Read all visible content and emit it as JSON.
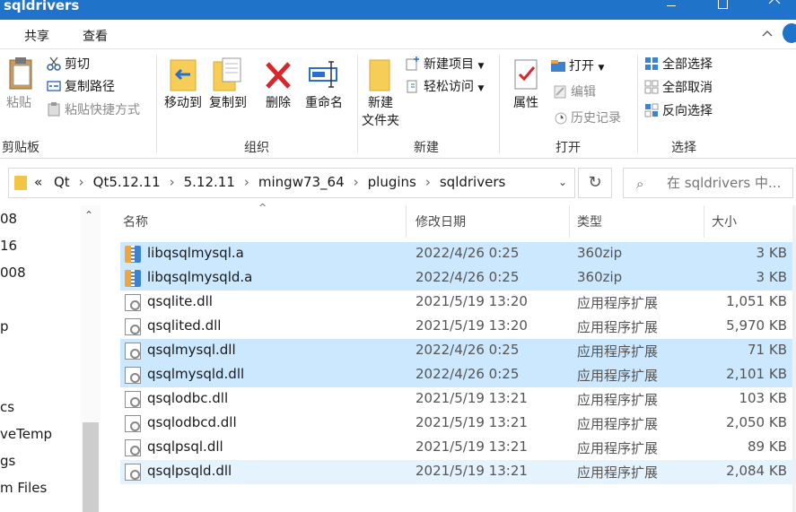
{
  "window": {
    "title": "sqldrivers"
  },
  "ribbon_tabs": [
    "共享",
    "查看"
  ],
  "ribbon": {
    "clipboard": {
      "label": "剪贴板",
      "paste": "粘贴",
      "cut": "剪切",
      "copy_path": "复制路径",
      "paste_shortcut": "粘贴快捷方式"
    },
    "organize": {
      "label": "组织",
      "move_to": "移动到",
      "copy_to": "复制到",
      "delete": "删除",
      "rename": "重命名"
    },
    "new": {
      "label": "新建",
      "new_folder_1": "新建",
      "new_folder_2": "文件夹",
      "new_item": "新建项目",
      "easy_access": "轻松访问"
    },
    "open": {
      "label": "打开",
      "properties": "属性",
      "open": "打开",
      "edit": "编辑",
      "history": "历史记录"
    },
    "select": {
      "label": "选择",
      "select_all": "全部选择",
      "select_none": "全部取消",
      "invert": "反向选择"
    }
  },
  "address": {
    "overflow": "«",
    "crumbs": [
      "Qt",
      "Qt5.12.11",
      "5.12.11",
      "mingw73_64",
      "plugins",
      "sqldrivers"
    ],
    "dropdown": "⌄",
    "refresh": "↻"
  },
  "search": {
    "placeholder": "在 sqldrivers 中..."
  },
  "nav": {
    "items": [
      "08",
      "16",
      "008",
      "",
      "p",
      "",
      "",
      "cs",
      "veTemp",
      "gs",
      "m Files"
    ]
  },
  "columns": {
    "name": "名称",
    "date": "修改日期",
    "type": "类型",
    "size": "大小"
  },
  "files": [
    {
      "name": "libqsqlmysql.a",
      "date": "2022/4/26 0:25",
      "type": "360zip",
      "size": "3 KB",
      "icon": "zip-icon",
      "state": "sel"
    },
    {
      "name": "libqsqlmysqld.a",
      "date": "2022/4/26 0:25",
      "type": "360zip",
      "size": "3 KB",
      "icon": "zip-icon",
      "state": "sel"
    },
    {
      "name": "qsqlite.dll",
      "date": "2021/5/19 13:20",
      "type": "应用程序扩展",
      "size": "1,051 KB",
      "icon": "dll-icon",
      "state": ""
    },
    {
      "name": "qsqlited.dll",
      "date": "2021/5/19 13:20",
      "type": "应用程序扩展",
      "size": "5,970 KB",
      "icon": "dll-icon",
      "state": ""
    },
    {
      "name": "qsqlmysql.dll",
      "date": "2022/4/26 0:25",
      "type": "应用程序扩展",
      "size": "71 KB",
      "icon": "dll-icon",
      "state": "sel"
    },
    {
      "name": "qsqlmysqld.dll",
      "date": "2022/4/26 0:25",
      "type": "应用程序扩展",
      "size": "2,101 KB",
      "icon": "dll-icon",
      "state": "sel"
    },
    {
      "name": "qsqlodbc.dll",
      "date": "2021/5/19 13:21",
      "type": "应用程序扩展",
      "size": "103 KB",
      "icon": "dll-icon",
      "state": ""
    },
    {
      "name": "qsqlodbcd.dll",
      "date": "2021/5/19 13:21",
      "type": "应用程序扩展",
      "size": "2,050 KB",
      "icon": "dll-icon",
      "state": ""
    },
    {
      "name": "qsqlpsql.dll",
      "date": "2021/5/19 13:21",
      "type": "应用程序扩展",
      "size": "89 KB",
      "icon": "dll-icon",
      "state": ""
    },
    {
      "name": "qsqlpsqld.dll",
      "date": "2021/5/19 13:21",
      "type": "应用程序扩展",
      "size": "2,084 KB",
      "icon": "dll-icon",
      "state": "hl"
    }
  ]
}
